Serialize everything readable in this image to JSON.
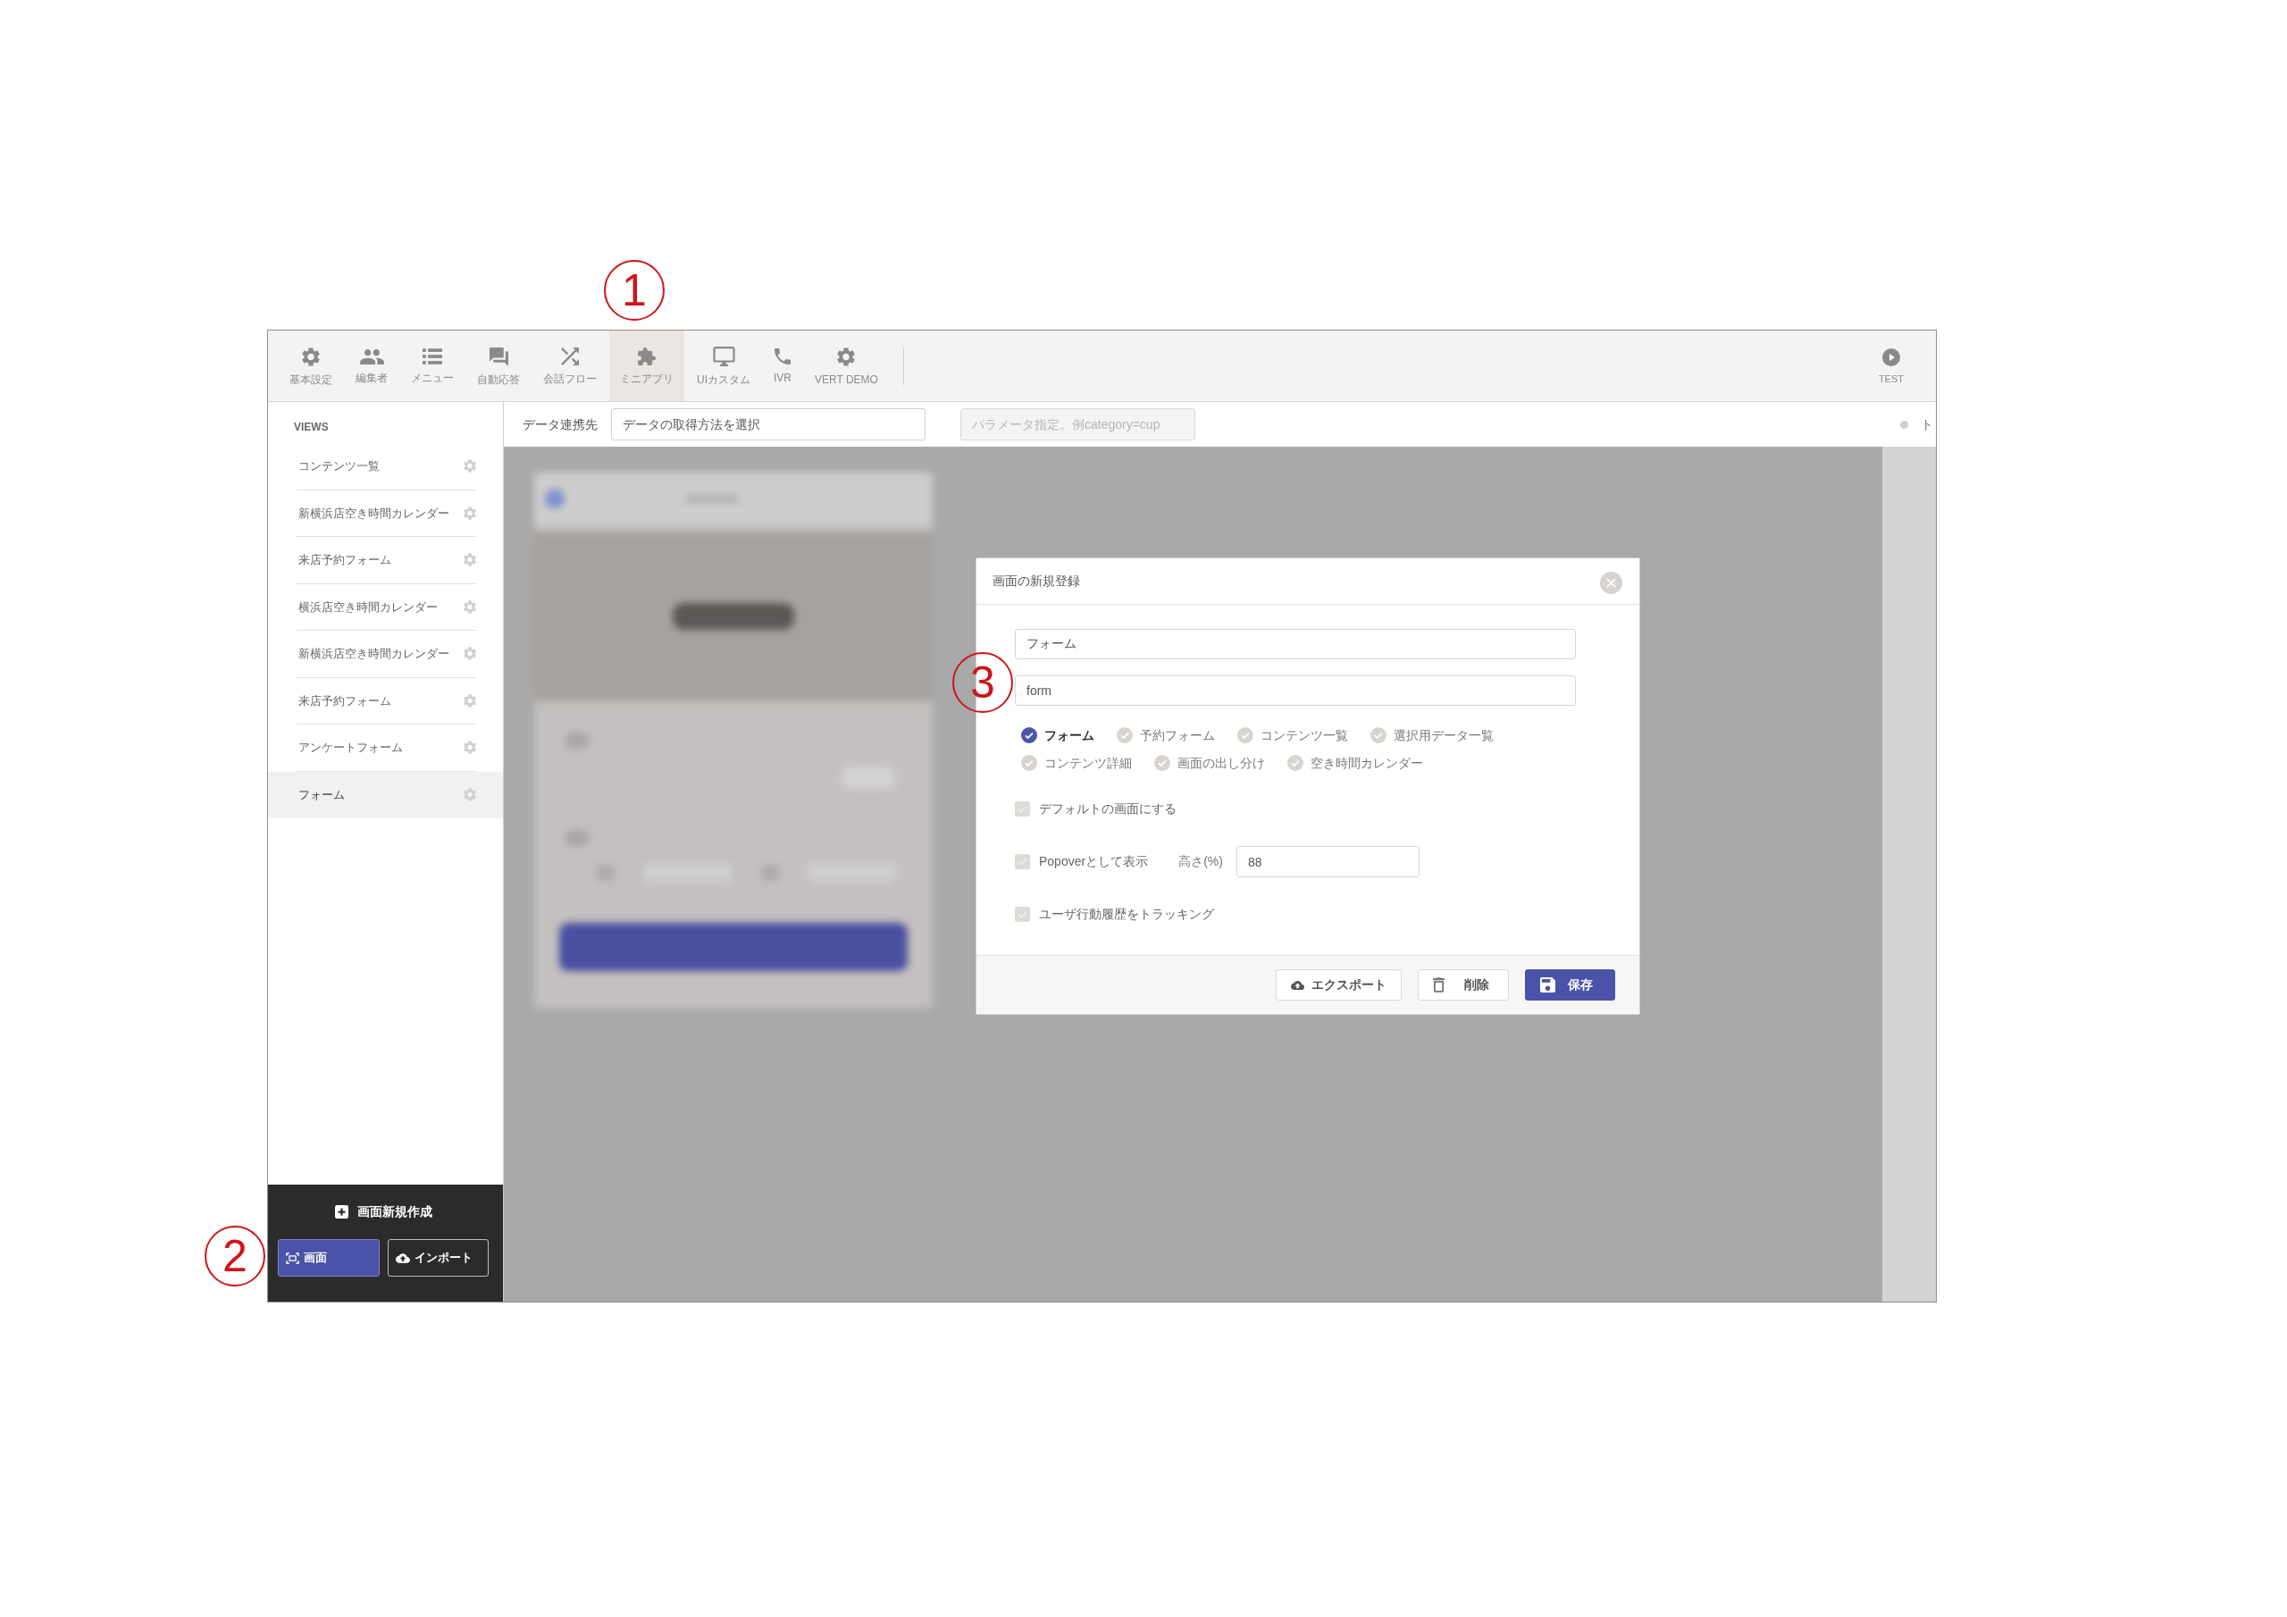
{
  "annotations": [
    {
      "label": "1"
    },
    {
      "label": "2"
    },
    {
      "label": "3"
    }
  ],
  "toolbar": {
    "items": [
      {
        "label": "基本設定",
        "selected": false
      },
      {
        "label": "編集者",
        "selected": false
      },
      {
        "label": "メニュー",
        "selected": false
      },
      {
        "label": "自動応答",
        "selected": false
      },
      {
        "label": "会話フロー",
        "selected": false
      },
      {
        "label": "ミニアプリ",
        "selected": true
      },
      {
        "label": "UIカスタム",
        "selected": false
      },
      {
        "label": "IVR",
        "selected": false
      },
      {
        "label": "VERT DEMO",
        "selected": false
      }
    ],
    "test_button": {
      "label": "TEST"
    }
  },
  "sidebar": {
    "title": "VIEWS",
    "views": [
      {
        "label": "コンテンツ一覧",
        "selected": false
      },
      {
        "label": "新横浜店空き時間カレンダー",
        "selected": false
      },
      {
        "label": "来店予約フォーム",
        "selected": false
      },
      {
        "label": "横浜店空き時間カレンダー",
        "selected": false
      },
      {
        "label": "新横浜店空き時間カレンダー",
        "selected": false
      },
      {
        "label": "来店予約フォーム",
        "selected": false
      },
      {
        "label": "アンケートフォーム",
        "selected": false
      },
      {
        "label": "フォーム",
        "selected": true
      }
    ],
    "create_label": "画面新規作成",
    "buttons": [
      {
        "label": "画面",
        "kind": "primary"
      },
      {
        "label": "インポート",
        "kind": "outline"
      }
    ]
  },
  "data_bar": {
    "label": "データ連携先",
    "source_select": {
      "value": "データの取得方法を選択"
    },
    "params_field": {
      "placeholder": "パラメータ指定。例category=cup",
      "disabled": true
    },
    "edge_text": "ト"
  },
  "dialog": {
    "title": "画面の新規登録",
    "name_field": {
      "value": "フォーム"
    },
    "key_field": {
      "value": "form"
    },
    "types": [
      {
        "label": "フォーム",
        "selected": true
      },
      {
        "label": "予約フォーム",
        "selected": false
      },
      {
        "label": "コンテンツ一覧",
        "selected": false
      },
      {
        "label": "選択用データ一覧",
        "selected": false
      },
      {
        "label": "コンテンツ詳細",
        "selected": false
      },
      {
        "label": "画面の出し分け",
        "selected": false
      },
      {
        "label": "空き時間カレンダー",
        "selected": false
      }
    ],
    "options": [
      {
        "label": "デフォルトの画面にする",
        "checked": false
      },
      {
        "label": "Popoverとして表示",
        "checked": false,
        "height_field": {
          "label": "高さ(%)",
          "value": "88"
        }
      },
      {
        "label": "ユーザ行動履歴をトラッキング",
        "checked": false
      }
    ],
    "buttons": [
      {
        "label": "エクスポート",
        "kind": "default"
      },
      {
        "label": "削除",
        "kind": "default"
      },
      {
        "label": "保存",
        "kind": "primary"
      }
    ]
  }
}
